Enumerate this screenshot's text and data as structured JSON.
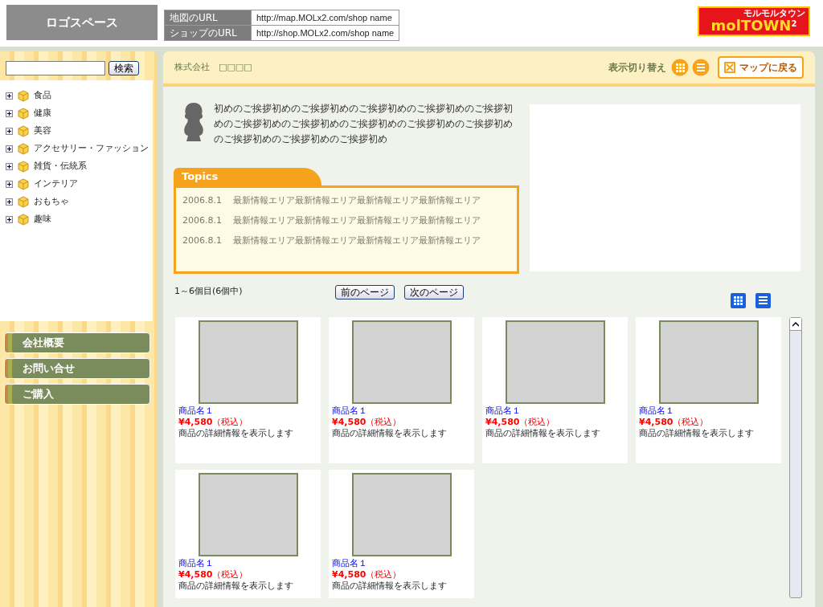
{
  "header": {
    "logo_space": "ロゴスペース",
    "urls": [
      {
        "label": "地図のURL",
        "value": "http://map.MOLx2.com/shop name"
      },
      {
        "label": "ショップのURL",
        "value": "http://shop.MOLx2.com/shop name"
      }
    ],
    "brand": {
      "text": "molTOWN",
      "sup": "2",
      "sub": "モルモルタウン"
    }
  },
  "sidebar": {
    "search": {
      "button": "検索"
    },
    "categories": [
      {
        "label": "食品",
        "expanded": false
      },
      {
        "label": "健康",
        "expanded": false
      },
      {
        "label": "美容",
        "expanded": false
      },
      {
        "label": "アクセサリー・ファッション",
        "expanded": false
      },
      {
        "label": "雑貨・伝統系",
        "expanded": false
      },
      {
        "label": "インテリア",
        "expanded": false
      },
      {
        "label": "おもちゃ",
        "expanded": false
      },
      {
        "label": "趣味",
        "expanded": false
      }
    ],
    "menu": [
      "会社概要",
      "お問い合せ",
      "ご購入"
    ]
  },
  "main": {
    "company": "株式会社　□□□□",
    "view_switch_label": "表示切り替え",
    "back_button": "マップに戻る",
    "greeting": "初めのご挨拶初めのご挨拶初めのご挨拶初めのご挨拶初めのご挨拶初めのご挨拶初めのご挨拶初めのご挨拶初めのご挨拶初めのご挨拶初めのご挨拶初めのご挨拶初めのご挨拶初め",
    "topics": {
      "title": "Topics",
      "items": [
        {
          "date": "2006.8.1",
          "text": "最新情報エリア最新情報エリア最新情報エリア最新情報エリア"
        },
        {
          "date": "2006.8.1",
          "text": "最新情報エリア最新情報エリア最新情報エリア最新情報エリア"
        },
        {
          "date": "2006.8.1",
          "text": "最新情報エリア最新情報エリア最新情報エリア最新情報エリア"
        }
      ]
    },
    "count": "1～6個目(6個中)",
    "prev": "前のページ",
    "next": "次のページ",
    "products": [
      {
        "name": "商品名１",
        "price": "¥4,580",
        "tax": "（税込）",
        "desc": "商品の詳細情報を表示します"
      },
      {
        "name": "商品名１",
        "price": "¥4,580",
        "tax": "（税込）",
        "desc": "商品の詳細情報を表示します"
      },
      {
        "name": "商品名１",
        "price": "¥4,580",
        "tax": "（税込）",
        "desc": "商品の詳細情報を表示します"
      },
      {
        "name": "商品名１",
        "price": "¥4,580",
        "tax": "（税込）",
        "desc": "商品の詳細情報を表示します"
      },
      {
        "name": "商品名１",
        "price": "¥4,580",
        "tax": "（税込）",
        "desc": "商品の詳細情報を表示します"
      },
      {
        "name": "商品名１",
        "price": "¥4,580",
        "tax": "（税込）",
        "desc": "商品の詳細情報を表示します"
      }
    ]
  }
}
